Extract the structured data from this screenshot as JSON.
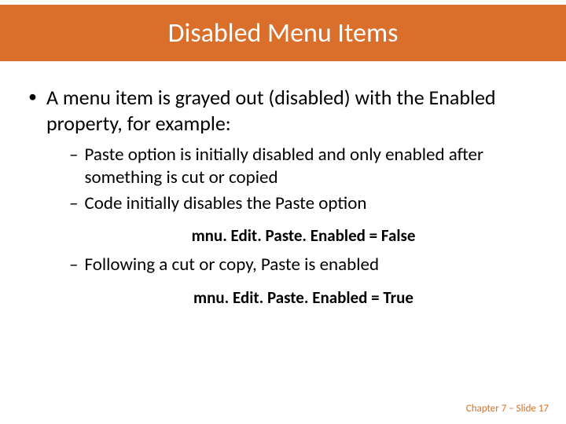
{
  "title": "Disabled Menu Items",
  "main_bullet": "A menu item is grayed out (disabled) with the Enabled property, for example:",
  "sub": {
    "s1": "Paste option is initially disabled and only enabled after something is cut or copied",
    "s2": "Code initially disables the Paste option",
    "s3": "Following a cut or copy, Paste is enabled"
  },
  "code": {
    "c1": "mnu. Edit. Paste. Enabled = False",
    "c2": "mnu. Edit. Paste. Enabled = True"
  },
  "footer": "Chapter 7 – Slide 17",
  "colors": {
    "accent": "#d96f2b"
  }
}
